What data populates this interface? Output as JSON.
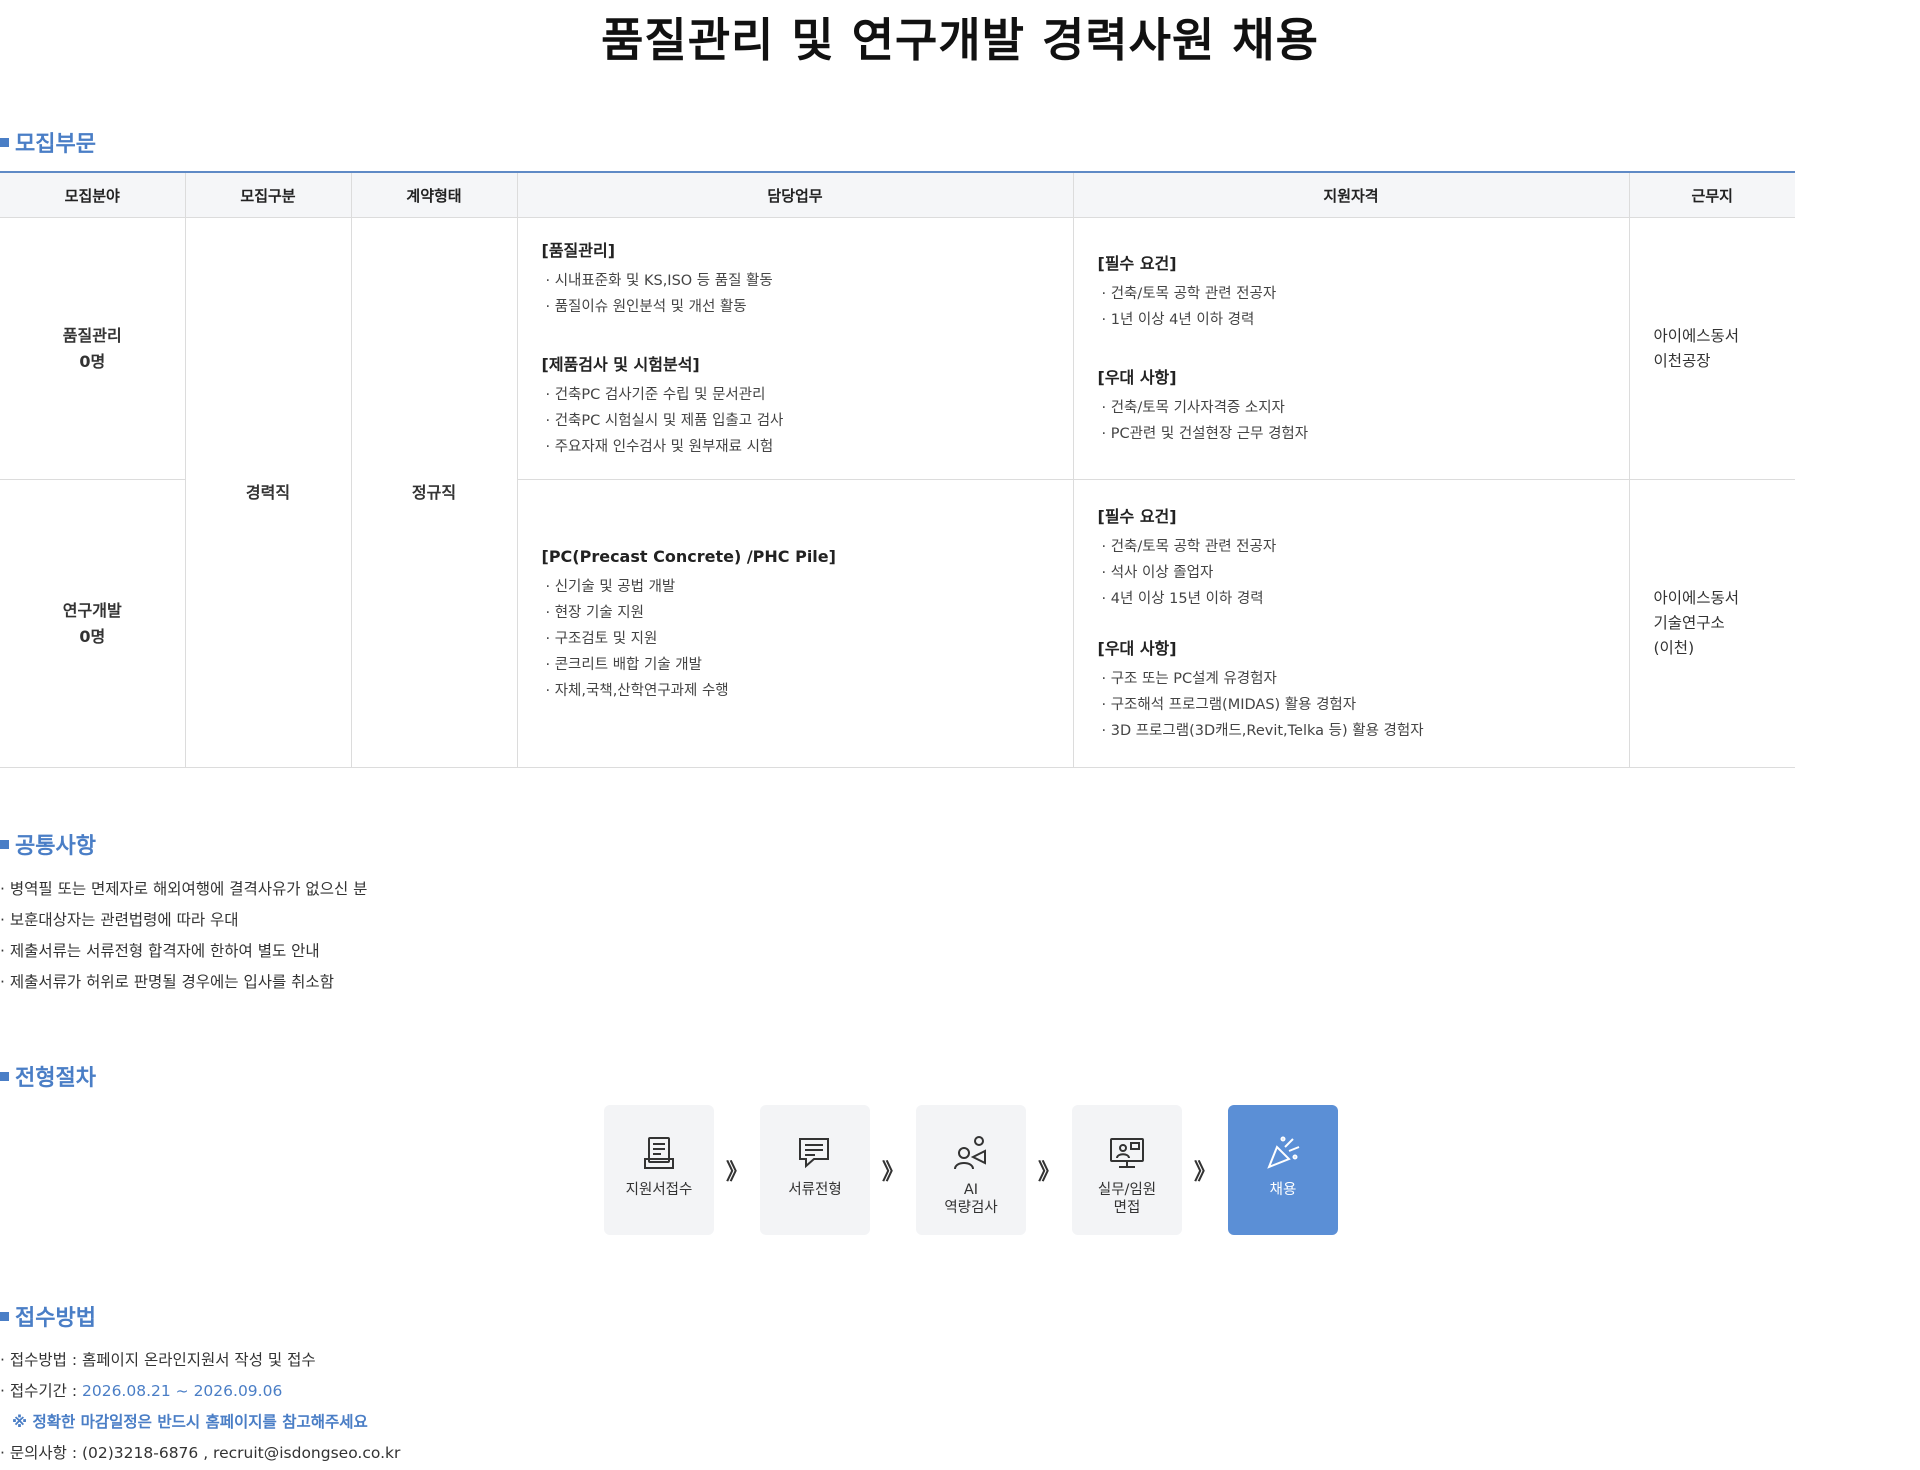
{
  "title": "품질관리 및 연구개발 경력사원 채용",
  "sections": {
    "recruit": "모집부문",
    "common": "공통사항",
    "process": "전형절차",
    "apply": "접수방법"
  },
  "table": {
    "headers": [
      "모집분야",
      "모집구분",
      "계약형태",
      "담당업무",
      "지원자격",
      "근무지"
    ],
    "shared": {
      "category": "경력직",
      "contract": "정규직"
    },
    "rows": [
      {
        "field": "품질관리",
        "count": "0명",
        "duties": [
          {
            "title": "[품질관리]",
            "items": [
              "시내표준화 및 KS,ISO 등 품질 활동",
              "품질이슈 원인분석 및 개선 활동"
            ]
          },
          {
            "title": "[제품검사 및 시험분석]",
            "items": [
              "건축PC 검사기준 수립 및 문서관리",
              "건축PC 시험실시 및 제품 입출고 검사",
              "주요자재 인수검사 및 원부재료 시험"
            ]
          }
        ],
        "qualifications": [
          {
            "title": "[필수 요건]",
            "items": [
              "건축/토목 공학 관련 전공자",
              "1년 이상 4년 이하 경력"
            ]
          },
          {
            "title": "[우대 사항]",
            "items": [
              "건축/토목 기사자격증 소지자",
              "PC관련 및 건설현장 근무 경험자"
            ]
          }
        ],
        "location": [
          "아이에스동서",
          "이천공장"
        ]
      },
      {
        "field": "연구개발",
        "count": "0명",
        "duties": [
          {
            "title": "[PC(Precast Concrete) /PHC Pile]",
            "items": [
              "신기술 및 공법 개발",
              "현장 기술 지원",
              "구조검토 및 지원",
              "콘크리트 배합 기술 개발",
              "자체,국책,산학연구과제 수행"
            ]
          }
        ],
        "qualifications": [
          {
            "title": "[필수 요건]",
            "items": [
              "건축/토목 공학 관련 전공자",
              "석사 이상 졸업자",
              "4년 이상 15년 이하 경력"
            ]
          },
          {
            "title": "[우대 사항]",
            "items": [
              "구조 또는 PC설계 유경험자",
              "구조해석 프로그램(MIDAS) 활용 경험자",
              "3D 프로그램(3D캐드,Revit,Telka 등) 활용 경험자"
            ]
          }
        ],
        "location": [
          "아이에스동서",
          "기술연구소",
          "(이천)"
        ]
      }
    ]
  },
  "common_notes": [
    "병역필 또는 면제자로 해외여행에 결격사유가 없으신 분",
    "보훈대상자는 관련법령에 따라 우대",
    "제출서류는 서류전형 합격자에 한하여 별도 안내",
    "제출서류가 허위로 판명될 경우에는 입사를 취소함"
  ],
  "process": {
    "arrow": "》",
    "steps": [
      {
        "label": "지원서접수",
        "icon": "application-form-icon"
      },
      {
        "label": "서류전형",
        "icon": "document-review-icon"
      },
      {
        "label": "AI\n역량검사",
        "icon": "ai-assessment-icon"
      },
      {
        "label": "실무/임원\n면접",
        "icon": "interview-monitor-icon"
      },
      {
        "label": "채용",
        "icon": "celebration-icon"
      }
    ],
    "final_color": "#5b8fd6"
  },
  "apply": {
    "method": "접수방법 : 홈페이지 온라인지원서 작성 및 접수",
    "period_label": "접수기간 : ",
    "period_value": "2026.08.21 ~ 2026.09.06",
    "notice": "※ 정확한 마감일정은 반드시 홈페이지를 참고해주세요",
    "contact": "문의사항 : (02)3218-6876 , recruit@isdongseo.co.kr"
  },
  "colors": {
    "accent": "#4a7ec6",
    "table_border_top": "#5f8ac6",
    "header_bg": "#f5f6f8"
  }
}
